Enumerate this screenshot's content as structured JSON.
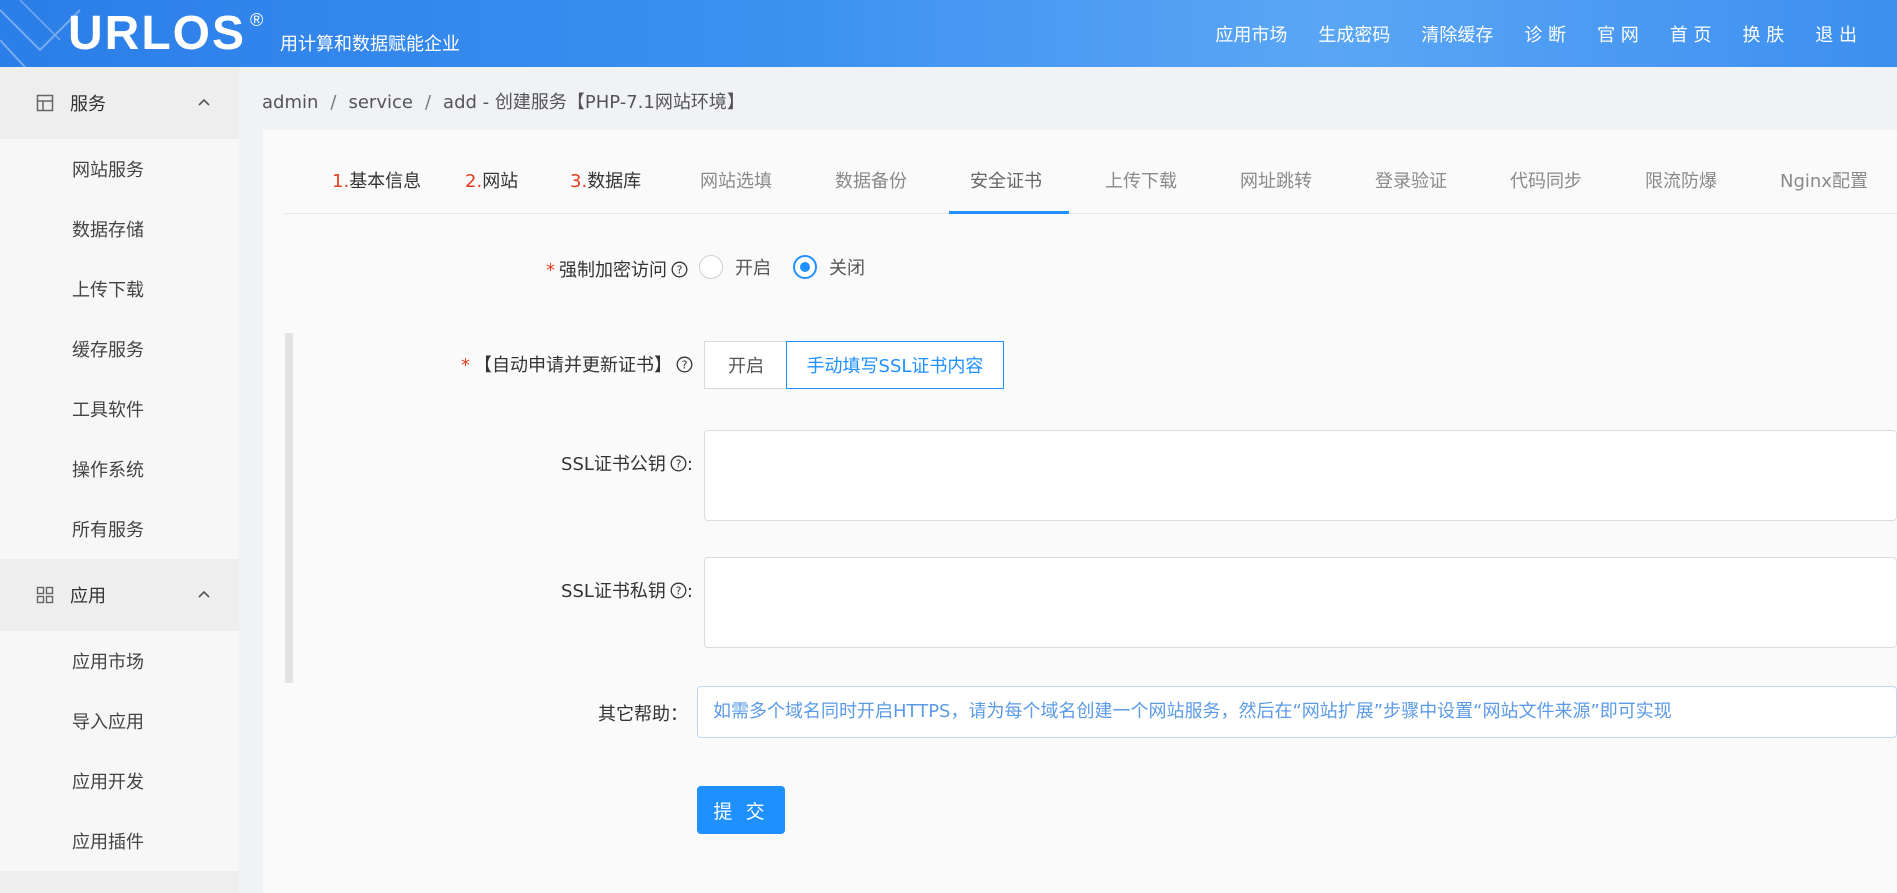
{
  "header": {
    "logo": "URLOS",
    "logo_mark": "®",
    "slogan": "用计算和数据赋能企业",
    "nav": [
      "应用市场",
      "生成密码",
      "清除缓存",
      "诊 断",
      "官 网",
      "首 页",
      "换 肤",
      "退 出"
    ]
  },
  "sidebar": {
    "groups": [
      {
        "label": "服务",
        "icon": "service-icon",
        "items": [
          "网站服务",
          "数据存储",
          "上传下载",
          "缓存服务",
          "工具软件",
          "操作系统",
          "所有服务"
        ]
      },
      {
        "label": "应用",
        "icon": "apps-grid-icon",
        "items": [
          "应用市场",
          "导入应用",
          "应用开发",
          "应用插件"
        ]
      }
    ]
  },
  "breadcrumb": {
    "parts": [
      "admin",
      "service",
      "add"
    ],
    "separator": "/",
    "title": "创建服务【PHP-7.1网站环境】"
  },
  "tabs": [
    {
      "num": "1.",
      "label": "基本信息"
    },
    {
      "num": "2.",
      "label": "网站"
    },
    {
      "num": "3.",
      "label": "数据库"
    },
    {
      "num": "",
      "label": "网站选填"
    },
    {
      "num": "",
      "label": "数据备份"
    },
    {
      "num": "",
      "label": "安全证书"
    },
    {
      "num": "",
      "label": "上传下载"
    },
    {
      "num": "",
      "label": "网址跳转"
    },
    {
      "num": "",
      "label": "登录验证"
    },
    {
      "num": "",
      "label": "代码同步"
    },
    {
      "num": "",
      "label": "限流防爆"
    },
    {
      "num": "",
      "label": "Nginx配置"
    }
  ],
  "active_tab": "安全证书",
  "form": {
    "force_https": {
      "label": "强制加密访问",
      "options": [
        "开启",
        "关闭"
      ],
      "selected": "关闭"
    },
    "auto_cert": {
      "label": "【自动申请并更新证书】",
      "options": [
        "开启",
        "手动填写SSL证书内容"
      ],
      "selected": "手动填写SSL证书内容"
    },
    "ssl_public": {
      "label": "SSL证书公钥",
      "value": ""
    },
    "ssl_private": {
      "label": "SSL证书私钥",
      "value": ""
    },
    "other_help": {
      "label": "其它帮助：",
      "text": "如需多个域名同时开启HTTPS，请为每个域名创建一个网站服务，然后在“网站扩展”步骤中设置“网站文件来源”即可实现"
    },
    "submit_label": "提 交"
  },
  "colors": {
    "accent": "#1e90ff",
    "required": "#e43d1e",
    "header": "#3a8ef0"
  }
}
